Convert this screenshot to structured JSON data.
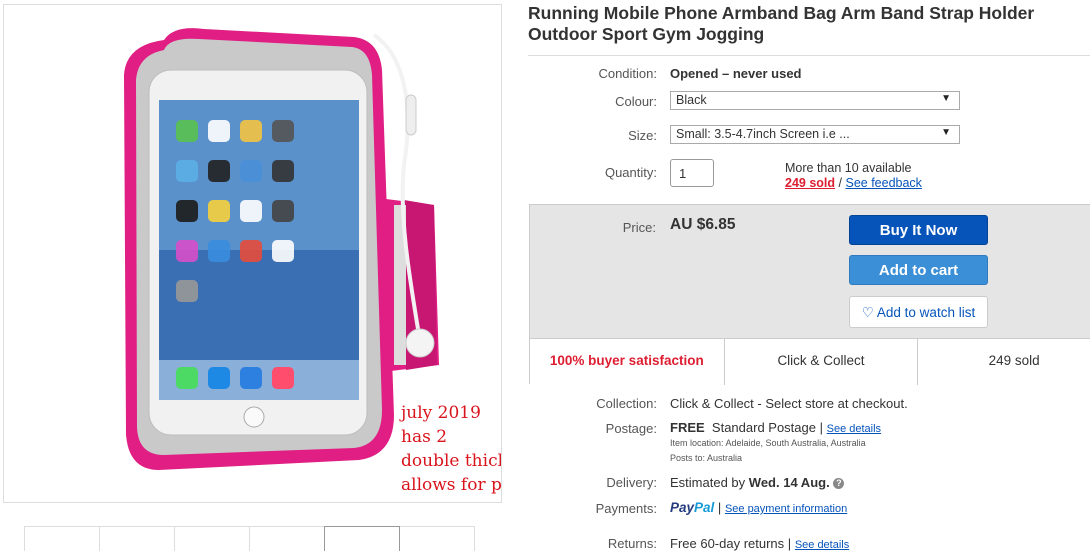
{
  "product": {
    "title": "Running Mobile Phone Armband Bag Arm Band Strap Holder Outdoor Sport Gym Jogging"
  },
  "image": {
    "caption_lines": [
      "july 2019",
      "has 2",
      "double thickness",
      "allows for power bank"
    ],
    "accent_color": "#e01e84",
    "thumbnail_count": 6,
    "active_thumbnail": 5
  },
  "details": {
    "condition_label": "Condition:",
    "condition_value": "Opened – never used",
    "colour_label": "Colour:",
    "colour_value": "Black",
    "size_label": "Size:",
    "size_value": "Small: 3.5-4.7inch Screen i.e ...",
    "quantity_label": "Quantity:",
    "quantity_value": "1",
    "available_text": "More than 10 available",
    "sold_link": "249 sold",
    "separator": "/",
    "feedback_link": "See feedback"
  },
  "purchase": {
    "price_label": "Price:",
    "price_value": "AU $6.85",
    "buy_now": "Buy It Now",
    "add_to_cart": "Add to cart",
    "watch_list": "Add to watch list",
    "stats": [
      "100% buyer satisfaction",
      "Click & Collect",
      "249 sold"
    ]
  },
  "shipping": {
    "collection_label": "Collection:",
    "collection_value": "Click & Collect - Select store at checkout.",
    "postage_label": "Postage:",
    "postage_free": "FREE",
    "postage_method": "Standard Postage",
    "postage_sep": "|",
    "postage_details_link": "See details",
    "item_location": "Item location:  Adelaide, South Australia, Australia",
    "posts_to": "Posts to:  Australia",
    "delivery_label": "Delivery:",
    "delivery_prefix": "Estimated by",
    "delivery_date": "Wed. 14 Aug.",
    "payments_label": "Payments:",
    "paypal_pay": "Pay",
    "paypal_pal": "Pal",
    "payments_sep": "|",
    "payment_info_link": "See payment information",
    "returns_label": "Returns:",
    "returns_value": "Free 60-day returns",
    "returns_sep": "|",
    "returns_details_link": "See details"
  }
}
